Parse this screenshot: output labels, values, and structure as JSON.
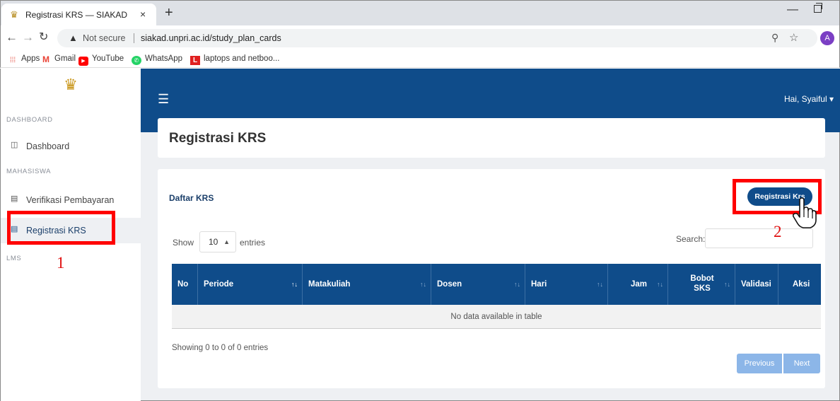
{
  "browser": {
    "tab_title": "Registrasi KRS — SIAKAD",
    "tab_close": "×",
    "new_tab": "+",
    "security_label": "Not secure",
    "url": "siakad.unpri.ac.id/study_plan_cards",
    "profile_initial": "A",
    "bookmarks": [
      {
        "label": "Apps",
        "icon": "apps-grid-icon",
        "color": "#e34133"
      },
      {
        "label": "Gmail",
        "icon": "gmail-icon",
        "color": "#ea4335"
      },
      {
        "label": "YouTube",
        "icon": "youtube-icon",
        "color": "#ff0000"
      },
      {
        "label": "WhatsApp",
        "icon": "whatsapp-icon",
        "color": "#25d366"
      },
      {
        "label": "laptops and netboo...",
        "icon": "bookmark-l-icon",
        "color": "#e02020"
      }
    ]
  },
  "sidebar": {
    "sections": [
      {
        "heading": "DASHBOARD",
        "items": [
          {
            "label": "Dashboard",
            "icon": "dashboard-icon"
          }
        ]
      },
      {
        "heading": "MAHASISWA",
        "items": [
          {
            "label": "Verifikasi Pembayaran",
            "icon": "document-icon"
          },
          {
            "label": "Registrasi KRS",
            "icon": "document-icon",
            "active": true
          }
        ]
      },
      {
        "heading": "LMS",
        "items": []
      }
    ]
  },
  "header": {
    "greeting": "Hai, Syaiful",
    "menu_icon": "hamburger-icon"
  },
  "page": {
    "title": "Registrasi KRS",
    "card_title": "Daftar KRS",
    "register_button": "Registrasi Krs",
    "show_label": "Show",
    "entries_value": "10",
    "entries_label": "entries",
    "search_label": "Search:",
    "search_value": "",
    "table": {
      "columns": [
        "No",
        "Periode",
        "Matakuliah",
        "Dosen",
        "Hari",
        "Jam",
        "Bobot SKS",
        "Validasi",
        "Aksi"
      ],
      "empty_message": "No data available in table"
    },
    "info": "Showing 0 to 0 of 0 entries",
    "pagination": {
      "previous": "Previous",
      "next": "Next"
    }
  },
  "annotations": {
    "step1": "1",
    "step2": "2",
    "color": "#ff0000"
  },
  "colors": {
    "primary": "#0f4c8a",
    "pagination_disabled": "#8cb6e8",
    "background": "#eef0f3"
  }
}
